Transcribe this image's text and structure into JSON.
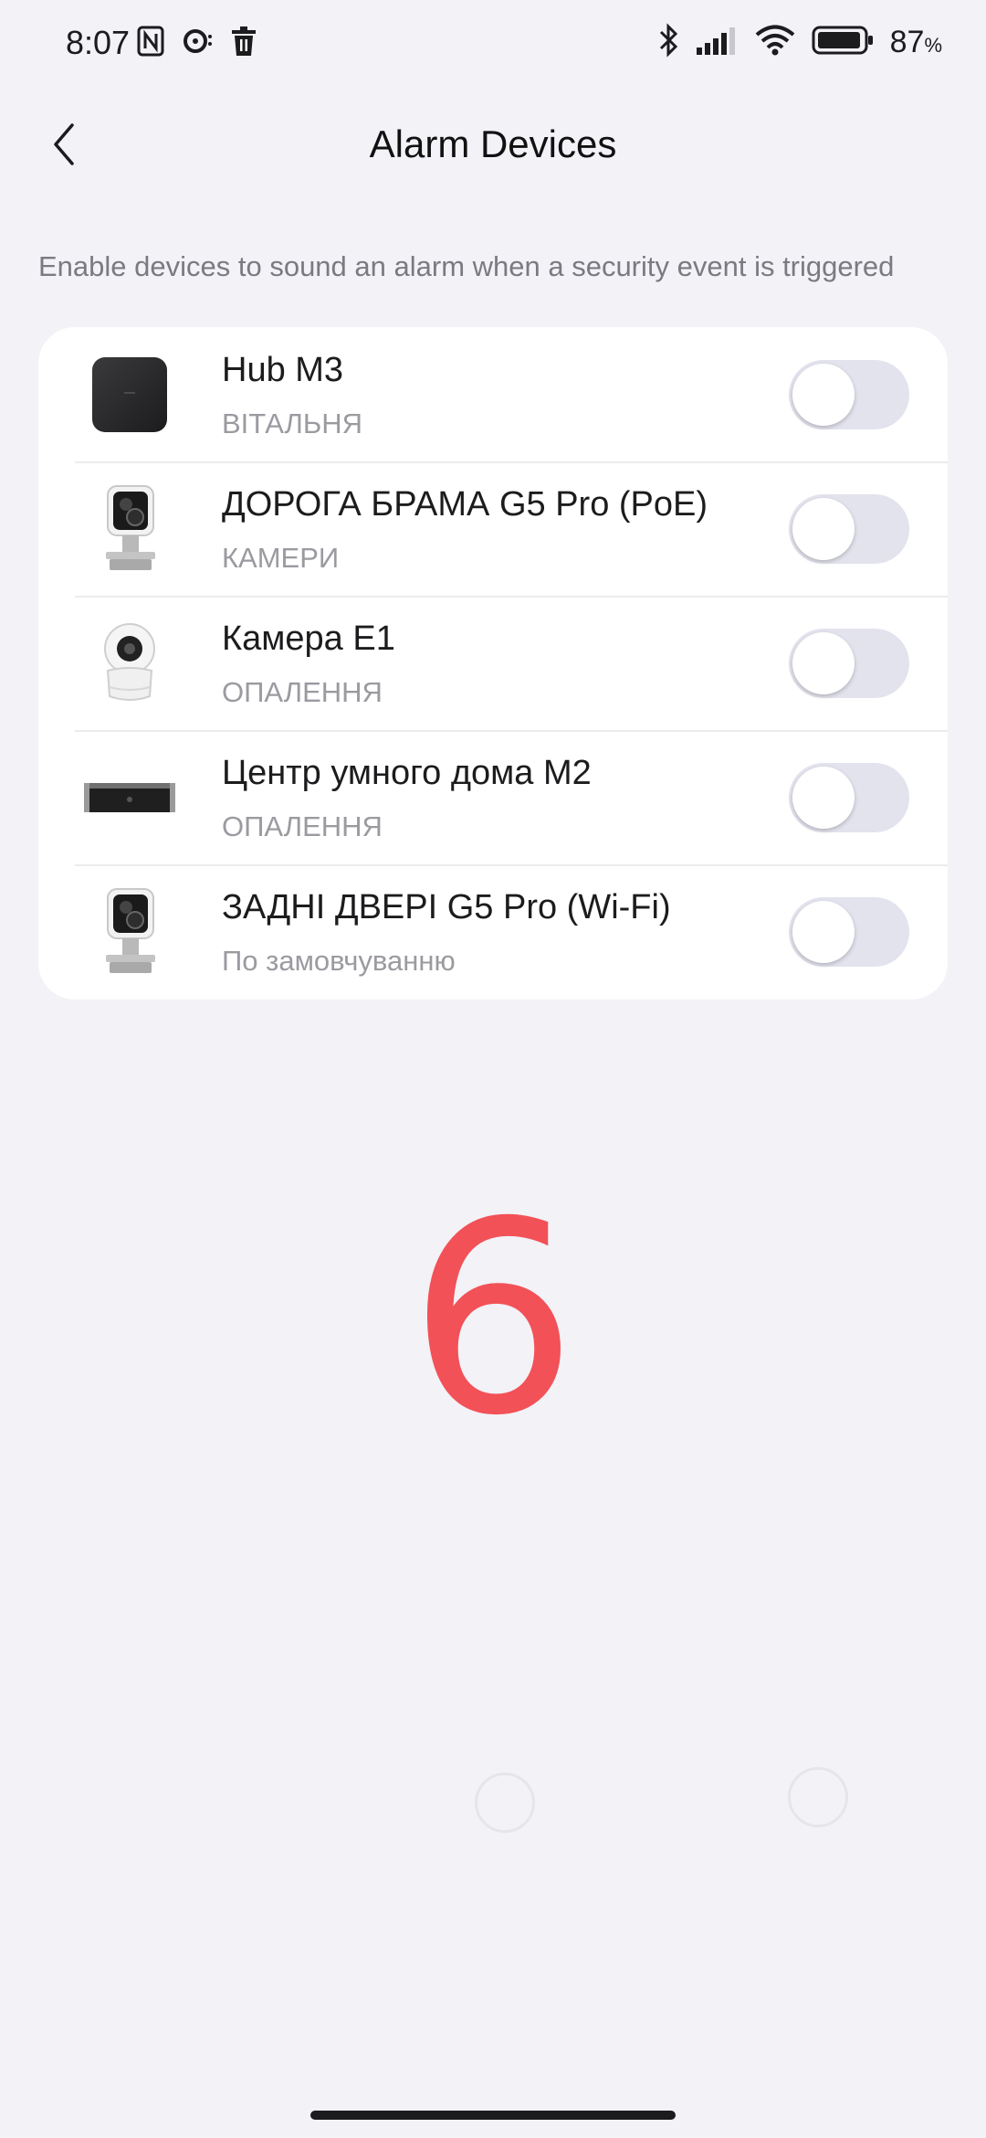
{
  "status_bar": {
    "time": "8:07",
    "left_icons": [
      "nfc-icon",
      "media-icon",
      "trash-icon"
    ],
    "right_icons": [
      "bluetooth-icon",
      "signal-icon",
      "wifi-icon",
      "battery-icon"
    ],
    "battery_value": "87",
    "battery_unit": "%"
  },
  "header": {
    "title": "Alarm Devices",
    "back_icon": "chevron-left-icon"
  },
  "subtitle": "Enable devices to sound an alarm when a security event is triggered",
  "devices": [
    {
      "name": "Hub M3",
      "room": "ВІТАЛЬНЯ",
      "icon": "hub-icon",
      "enabled": false
    },
    {
      "name": "ДОРОГА БРАМА G5 Pro (PoE)",
      "room": "КАМЕРИ",
      "icon": "camera-icon",
      "enabled": false
    },
    {
      "name": "Камера E1",
      "room": "ОПАЛЕННЯ",
      "icon": "dome-camera-icon",
      "enabled": false
    },
    {
      "name": "Центр умного дома M2",
      "room": "ОПАЛЕННЯ",
      "icon": "hub-m2-icon",
      "enabled": false
    },
    {
      "name": "ЗАДНІ ДВЕРІ G5 Pro (Wi-Fi)",
      "room": "По замовчуванню",
      "icon": "camera-icon",
      "enabled": false
    }
  ],
  "overlay_number": "6",
  "colors": {
    "background": "#f2f2f7",
    "card": "#ffffff",
    "toggle_off": "#e3e3ee",
    "overlay_number": "#f25157"
  }
}
